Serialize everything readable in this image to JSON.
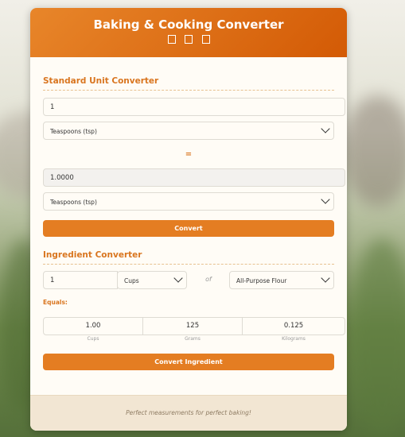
{
  "app": {
    "title": "Baking & Cooking Converter",
    "header_icons": [
      "icon-1",
      "icon-2",
      "icon-3"
    ],
    "accent_color": "#e47d22"
  },
  "standard": {
    "section_title": "Standard Unit Converter",
    "input_value": "1",
    "from_unit": "Teaspoons (tsp)",
    "equals_sign": "=",
    "output_value": "1.0000",
    "to_unit": "Teaspoons (tsp)",
    "convert_label": "Convert"
  },
  "ingredient": {
    "section_title": "Ingredient Converter",
    "amount": "1",
    "unit": "Cups",
    "of_label": "of",
    "ingredient": "All-Purpose Flour",
    "equals_label": "Equals:",
    "results": [
      {
        "value": "1.00",
        "label": "Cups"
      },
      {
        "value": "125",
        "label": "Grams"
      },
      {
        "value": "0.125",
        "label": "Kilograms"
      }
    ],
    "convert_label": "Convert Ingredient"
  },
  "footer": {
    "text": "Perfect measurements for perfect baking!"
  }
}
